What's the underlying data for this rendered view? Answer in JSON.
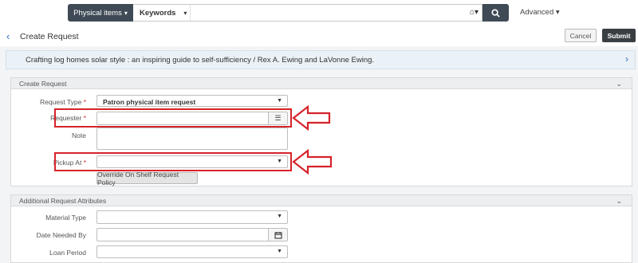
{
  "search": {
    "scope_label": "Physical items",
    "scope_caret": "▾",
    "keywords_label": "Keywords",
    "keywords_caret": "▾",
    "home_icon": "⌂▾",
    "advanced_label": "Advanced ▾"
  },
  "header": {
    "back_glyph": "‹",
    "title": "Create Request",
    "cancel_label": "Cancel",
    "submit_label": "Submit"
  },
  "banner": {
    "text": "Crafting log homes solar style : an inspiring guide to self-sufficiency / Rex A. Ewing and LaVonne Ewing.",
    "chevron": "›"
  },
  "create_section": {
    "title": "Create Request",
    "chevron": "⌄",
    "request_type_label": "Request Type",
    "request_type_value": "Patron physical item request",
    "requester_label": "Requester",
    "requester_value": "",
    "note_label": "Note",
    "pickup_label": "Pickup At",
    "pickup_value": "",
    "override_label": "Override On Shelf Request Policy",
    "required_mark": "*"
  },
  "attributes_section": {
    "title": "Additional Request Attributes",
    "chevron": "⌄",
    "material_type_label": "Material Type",
    "date_needed_label": "Date Needed By",
    "loan_period_label": "Loan Period"
  },
  "colors": {
    "accent": "#2a6ebb",
    "highlight": "#d6232a",
    "dark": "#3f4a56"
  }
}
